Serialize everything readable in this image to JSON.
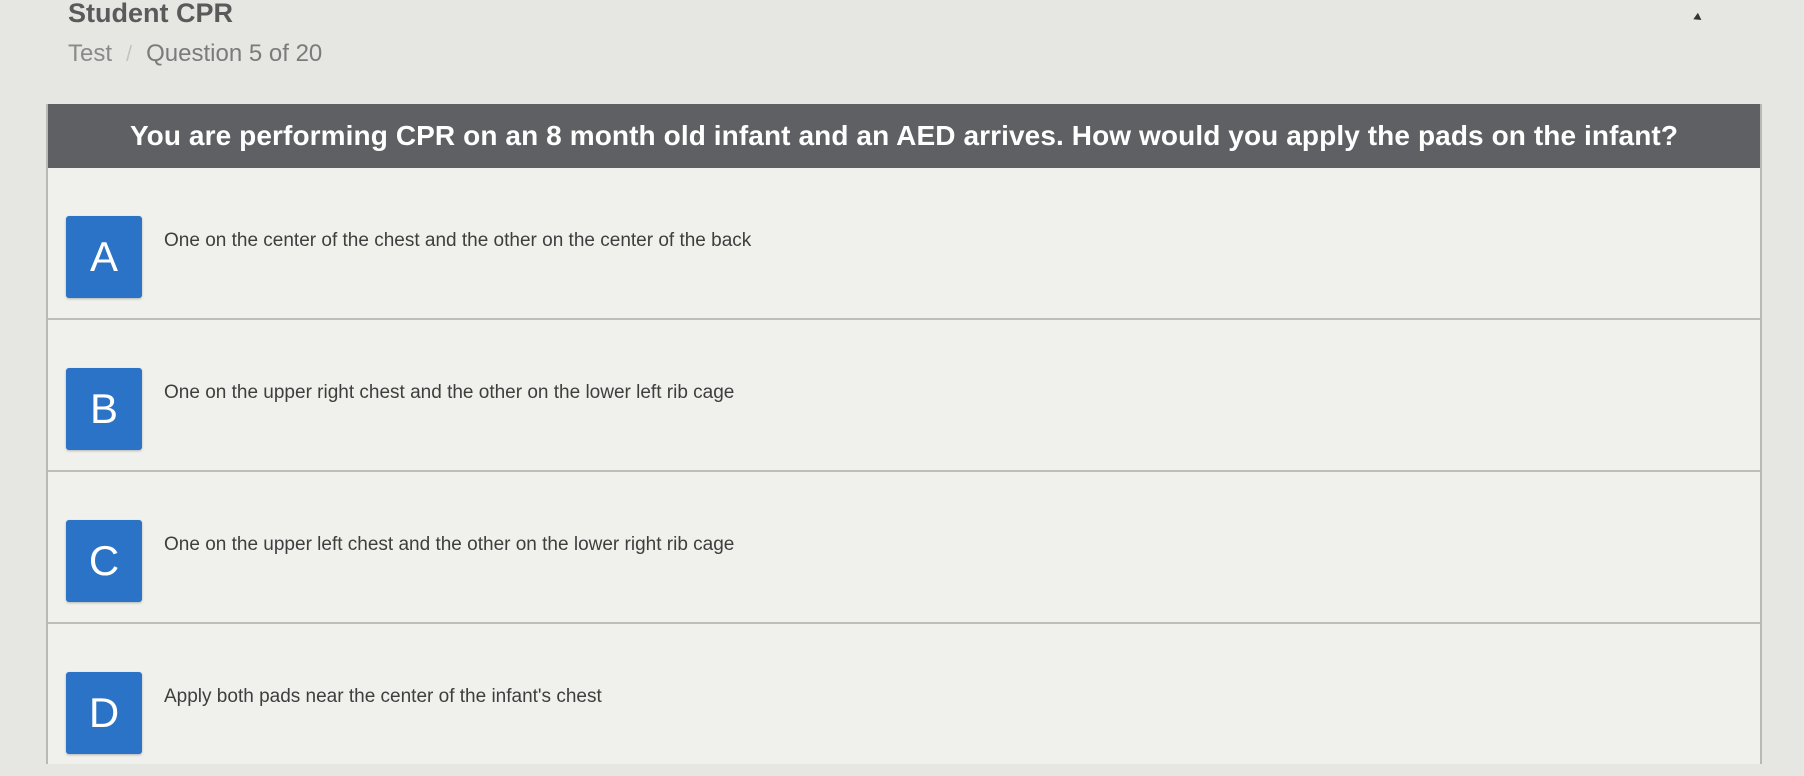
{
  "app": {
    "title": "Student CPR"
  },
  "breadcrumb": {
    "items": [
      "Test",
      "Question 5 of 20"
    ],
    "separator": "/"
  },
  "question": {
    "text": "You are performing CPR on an 8 month old infant and an AED arrives. How would you apply the pads on the infant?"
  },
  "options": [
    {
      "letter": "A",
      "text": "One on the center of the chest and the other on the center of the back"
    },
    {
      "letter": "B",
      "text": "One on the upper right chest and the other on the lower left rib cage"
    },
    {
      "letter": "C",
      "text": "One on the upper left chest and the other on the lower right rib cage"
    },
    {
      "letter": "D",
      "text": "Apply both pads near the center of the infant's chest"
    }
  ],
  "colors": {
    "badge": "#2a73c7",
    "question_bar": "#5f6063",
    "card_background": "#f0f0ec",
    "page_background": "#e6e7e3"
  },
  "icons": {
    "cursor": "mouse-pointer-icon"
  }
}
